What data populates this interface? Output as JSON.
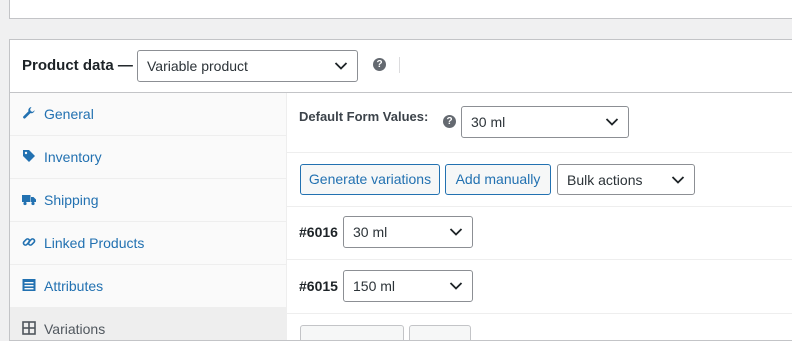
{
  "product_data": {
    "title": "Product data —",
    "type_select": {
      "value": "Variable product"
    },
    "help_icon": "question-icon"
  },
  "sidebar": {
    "items": [
      {
        "label": "General",
        "icon": "wrench-icon"
      },
      {
        "label": "Inventory",
        "icon": "tag-icon"
      },
      {
        "label": "Shipping",
        "icon": "truck-icon"
      },
      {
        "label": "Linked Products",
        "icon": "link-icon"
      },
      {
        "label": "Attributes",
        "icon": "list-icon"
      },
      {
        "label": "Variations",
        "icon": "grid-icon"
      }
    ]
  },
  "variations": {
    "default_form_values": {
      "label": "Default Form Values:",
      "value": "30 ml"
    },
    "buttons": {
      "generate": "Generate variations",
      "add_manually": "Add manually",
      "bulk_actions": "Bulk actions"
    },
    "items": [
      {
        "id": "#6016",
        "size": "30 ml"
      },
      {
        "id": "#6015",
        "size": "150 ml"
      }
    ]
  },
  "colors": {
    "accent": "#2271b1",
    "border": "#c3c4c7",
    "sidebar_bg": "#fafafa"
  }
}
